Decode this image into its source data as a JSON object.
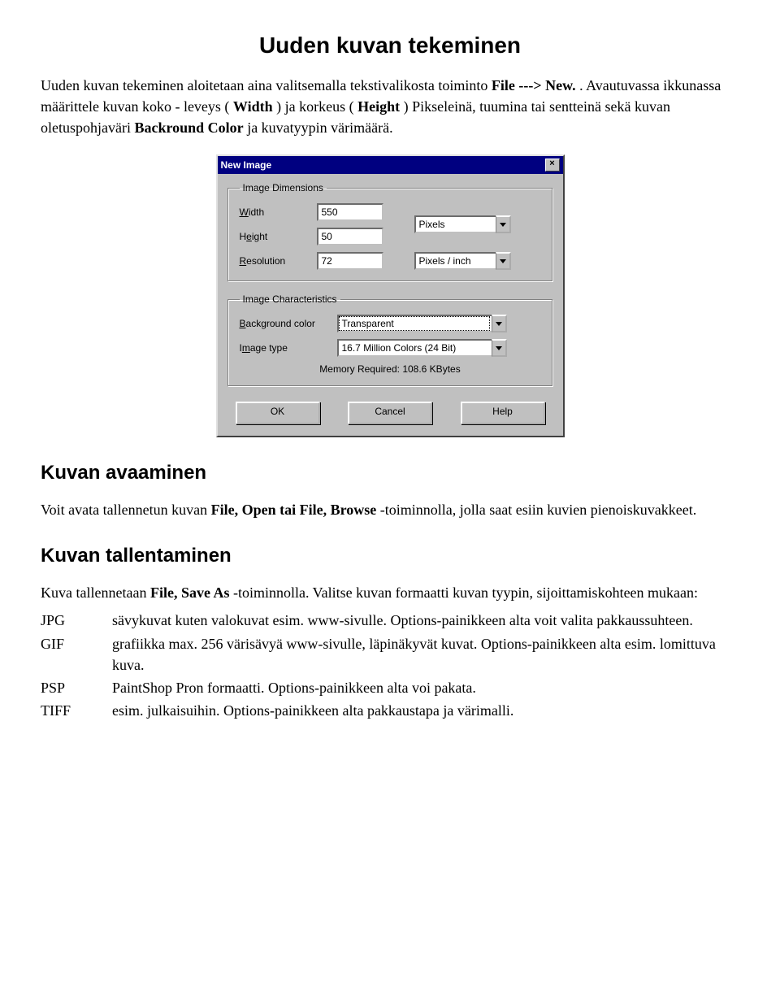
{
  "page": {
    "title": "Uuden kuvan tekeminen",
    "intro_parts": {
      "a": "Uuden kuvan tekeminen aloitetaan aina valitsemalla tekstivalikosta toiminto ",
      "b": "File ---> New.",
      "c": ". Avautuvassa ikkunassa määrittele kuvan koko - leveys (",
      "d": "Width",
      "e": ") ja korkeus (",
      "f": "Height",
      "g": ") Pikseleinä, tuumina tai sentteinä sekä kuvan oletuspohjaväri ",
      "h": "Backround Color",
      "i": " ja kuvatyypin värimäärä."
    }
  },
  "dialog": {
    "title": "New Image",
    "close": "×",
    "dim_legend": "Image Dimensions",
    "width_label": "Width",
    "height_label": "Height",
    "resolution_label": "Resolution",
    "width_value": "550",
    "height_value": "50",
    "resolution_value": "72",
    "unit1": "Pixels",
    "unit2": "Pixels / inch",
    "char_legend": "Image Characteristics",
    "bg_label": "Background color",
    "bg_value": "Transparent",
    "type_label": "Image type",
    "type_value": "16.7 Million Colors (24 Bit)",
    "memory": "Memory Required: 108.6 KBytes",
    "ok": "OK",
    "cancel": "Cancel",
    "help": "Help"
  },
  "open": {
    "heading": "Kuvan avaaminen",
    "p_a": "Voit avata tallennetun kuvan ",
    "p_b": "File, Open tai File, Browse",
    "p_c": "-toiminnolla, jolla saat esiin kuvien pienoiskuvakkeet."
  },
  "save": {
    "heading": "Kuvan tallentaminen",
    "p_a": "Kuva tallennetaan ",
    "p_b": "File, Save As",
    "p_c": "-toiminnolla. Valitse kuvan formaatti kuvan tyypin, sijoittamiskohteen mukaan:",
    "rows": [
      {
        "code": "JPG",
        "desc": "sävykuvat kuten valokuvat esim. www-sivulle. Options-painikkeen alta voit valita pakkaussuhteen."
      },
      {
        "code": "GIF",
        "desc": "grafiikka max. 256 värisävyä www-sivulle, läpinäkyvät kuvat. Options-painikkeen alta esim. lomittuva kuva."
      },
      {
        "code": "PSP",
        "desc": "PaintShop Pron formaatti. Options-painikkeen alta voi pakata."
      },
      {
        "code": "TIFF",
        "desc": "esim. julkaisuihin. Options-painikkeen alta pakkaustapa ja värimalli."
      }
    ]
  }
}
